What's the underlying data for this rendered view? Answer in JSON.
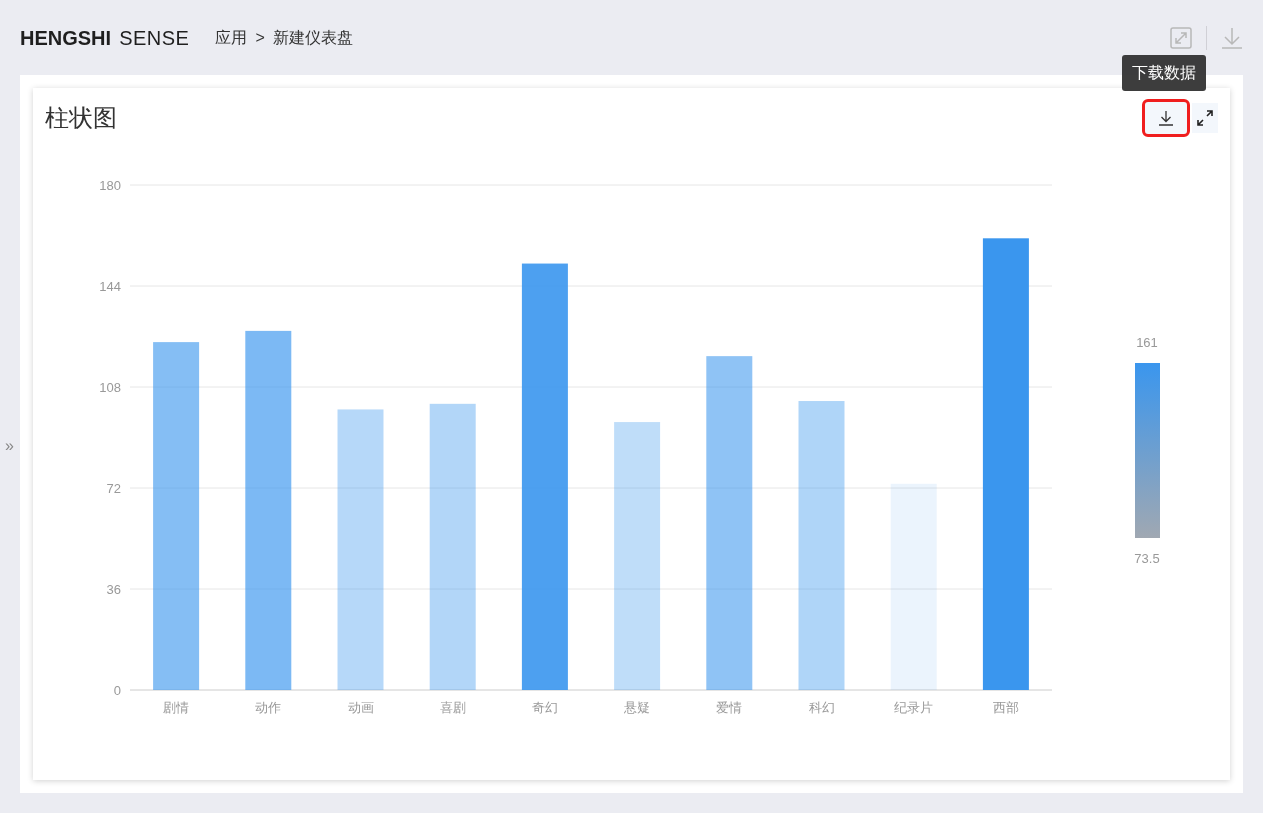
{
  "header": {
    "brand_bold": "HENGSHI",
    "brand_light": "SENSE",
    "breadcrumb": [
      {
        "label": "应用"
      },
      {
        "label": "新建仪表盘"
      }
    ],
    "breadcrumb_separator": ">"
  },
  "sidebar_toggle": "»",
  "card": {
    "title": "柱状图",
    "tooltip": "下载数据",
    "download_highlighted": true,
    "chart_data": {
      "type": "bar",
      "categories": [
        "剧情",
        "动作",
        "动画",
        "喜剧",
        "奇幻",
        "悬疑",
        "爱情",
        "科幻",
        "纪录片",
        "西部"
      ],
      "series": [
        {
          "color": "#3a96ee",
          "values": [
            124,
            128,
            100,
            102,
            152,
            95.5,
            119,
            103,
            73.5,
            161
          ]
        }
      ],
      "ylim": [
        0,
        180
      ],
      "grid": true,
      "yticks": [
        0,
        36,
        72,
        108,
        144,
        180
      ]
    },
    "visual_map": {
      "max": "161",
      "min": "73.5"
    }
  }
}
